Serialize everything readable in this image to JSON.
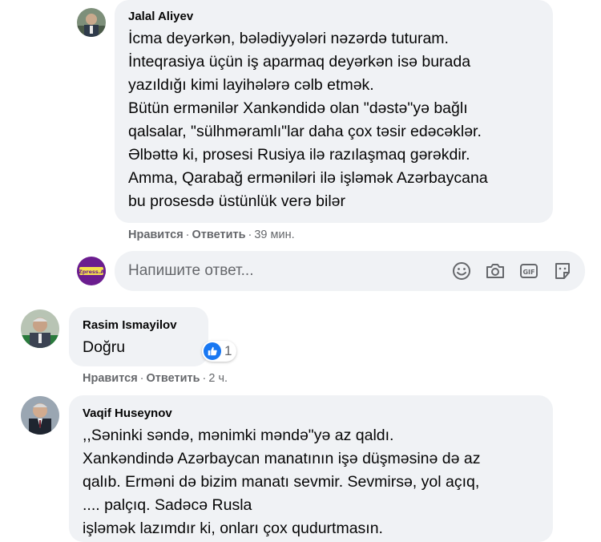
{
  "comments": [
    {
      "author": "Jalal Aliyev",
      "text": "İcma deyərkən, bələdiyyələri nəzərdə tuturam.\nİnteqrasiya üçün iş aparmaq deyərkən isə burada\nyazıldığı kimi layihələrə cəlb etmək.\nBütün ermənilər Xankəndidə olan \"dəstə\"yə bağlı\nqalsalar, \"sülhməramlı\"lar daha çox təsir edəcəklər.\nƏlbəttə ki, prosesi Rusiya ilə razılaşmaq gərəkdir.\nAmma, Qarabağ erməniləri ilə işləmək Azərbaycana\nbu prosesdə üstünlük verə bilər",
      "like_label": "Нравится",
      "dot1": "·",
      "reply_label": "Ответить",
      "dot2": "·",
      "time": "39 мин."
    },
    {
      "author": "Rasim Ismayilov",
      "text": "Doğru",
      "reaction_count": "1",
      "like_label": "Нравится",
      "dot1": "·",
      "reply_label": "Ответить",
      "dot2": "·",
      "time": "2 ч."
    },
    {
      "author": "Vaqif Huseynov",
      "text": ",,Səninki səndə, mənimki məndə\"yə az qaldı.\nXankəndində Azərbaycan manatının işə düşməsinə də az\nqalıb. Erməni də bizim manatı sevmir. Sevmirsə, yol açıq,\n.... palçıq. Sadəcə Rusla\nişləmək lazımdır ki, onları çox qudurtmasın."
    }
  ],
  "reply_box": {
    "placeholder": "Напишите ответ...",
    "avatar_text": "AZpress.AZ",
    "icons": [
      "emoji-icon",
      "camera-icon",
      "gif-icon",
      "sticker-icon"
    ]
  },
  "colors": {
    "bubble": "#f0f2f5",
    "meta_text": "#65676b",
    "like_blue": "#1877f2"
  }
}
